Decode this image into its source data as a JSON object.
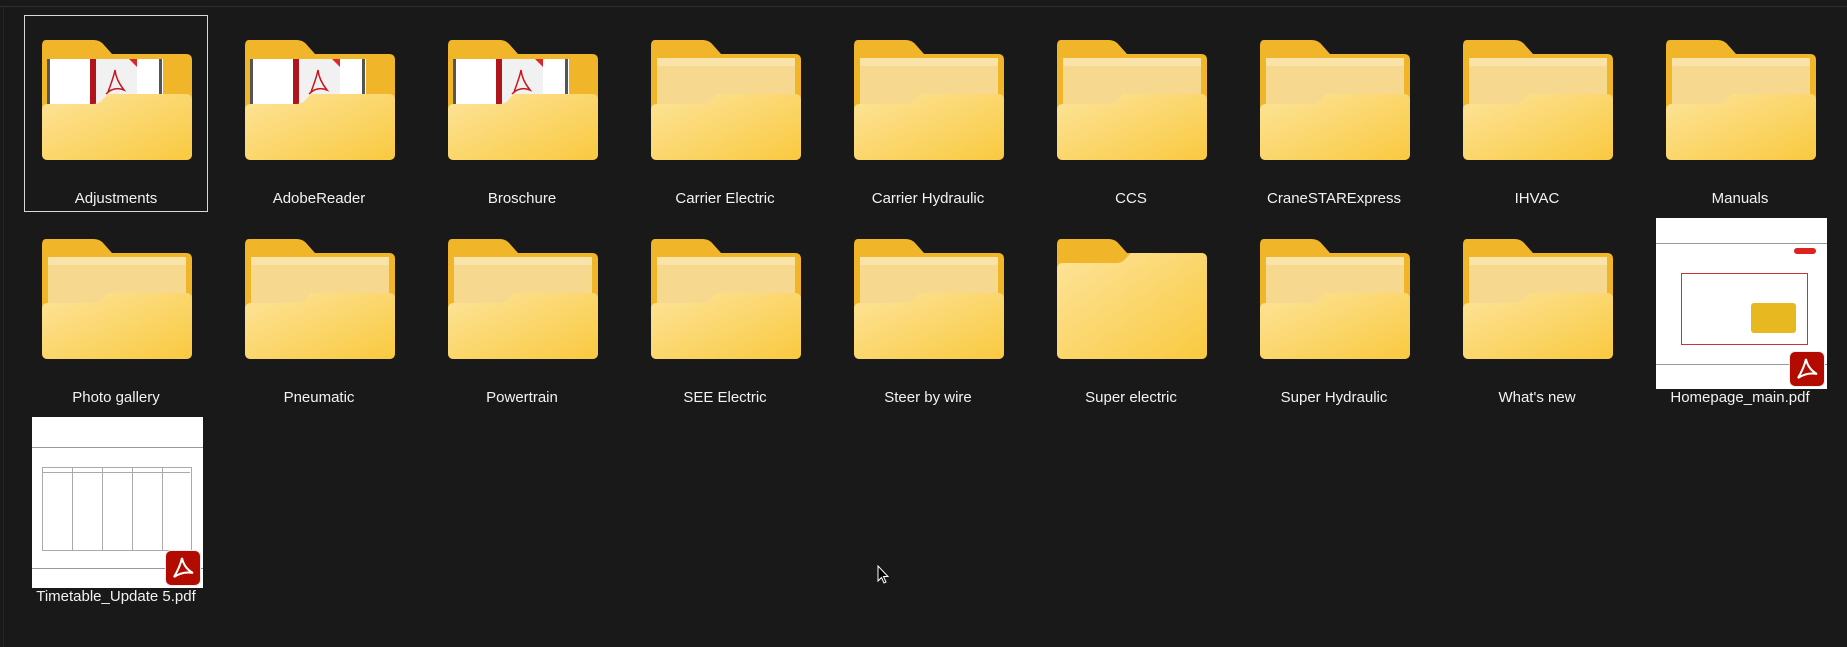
{
  "items": [
    {
      "label": "Adjustments",
      "icon": "pdf-folder-icon",
      "selected": true
    },
    {
      "label": "AdobeReader",
      "icon": "pdf-folder-icon"
    },
    {
      "label": "Broschure",
      "icon": "pdf-folder-icon"
    },
    {
      "label": "Carrier Electric",
      "icon": "folder-icon"
    },
    {
      "label": "Carrier Hydraulic",
      "icon": "folder-icon"
    },
    {
      "label": "CCS",
      "icon": "folder-icon"
    },
    {
      "label": "CraneSTARExpress",
      "icon": "folder-icon"
    },
    {
      "label": "IHVAC",
      "icon": "folder-icon"
    },
    {
      "label": "Manuals",
      "icon": "folder-icon"
    },
    {
      "label": "Photo gallery",
      "icon": "folder-icon"
    },
    {
      "label": "Pneumatic",
      "icon": "folder-icon"
    },
    {
      "label": "Powertrain",
      "icon": "folder-icon"
    },
    {
      "label": "SEE Electric",
      "icon": "folder-icon"
    },
    {
      "label": "Steer by wire",
      "icon": "folder-icon"
    },
    {
      "label": "Super electric",
      "icon": "empty-folder-icon"
    },
    {
      "label": "Super Hydraulic",
      "icon": "folder-icon"
    },
    {
      "label": "What's new",
      "icon": "folder-icon"
    },
    {
      "label": "Homepage_main.pdf",
      "icon": "pdf-thumbnail-homepage"
    },
    {
      "label": "Timetable_Update 5.pdf",
      "icon": "pdf-thumbnail-timetable"
    }
  ],
  "colors": {
    "background": "#191919",
    "folder_back": "#f0b429",
    "folder_front": "#fcd96e",
    "pdf_red": "#b30b00"
  }
}
